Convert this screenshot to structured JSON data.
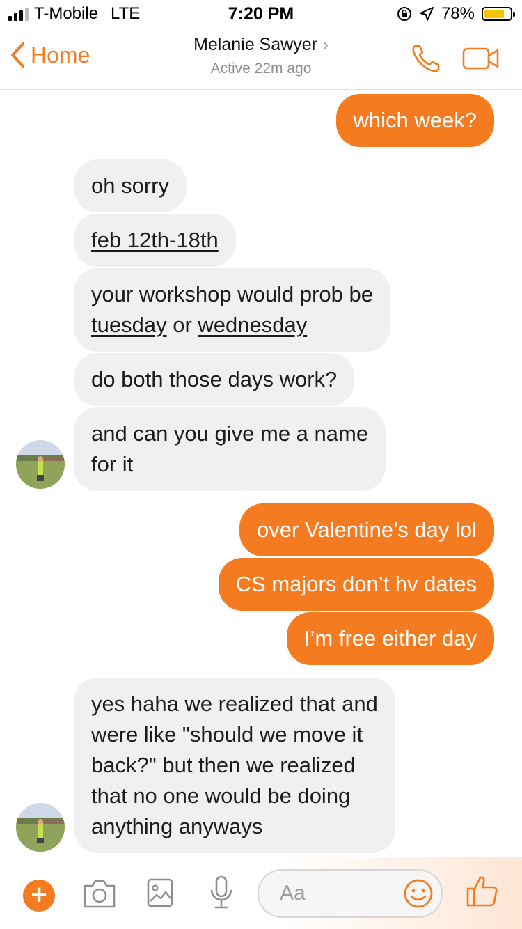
{
  "status_bar": {
    "carrier": "T-Mobile",
    "network": "LTE",
    "time": "7:20 PM",
    "battery_percent": "78%",
    "battery_level": 0.78,
    "colors": {
      "battery_fill": "#f5c400"
    }
  },
  "header": {
    "back_label": "Home",
    "contact_name": "Melanie Sawyer",
    "contact_status": "Active 22m ago",
    "accent": "#f47b20"
  },
  "messages": [
    {
      "from": "me",
      "text": "which week?"
    },
    {
      "from": "them",
      "text": "oh sorry"
    },
    {
      "from": "them",
      "text": "feb 12th-18th"
    },
    {
      "from": "them",
      "parts": [
        "your workshop would prob be",
        "tuesday",
        "or",
        "wednesday"
      ]
    },
    {
      "from": "them",
      "text": "do both those days work?"
    },
    {
      "from": "them",
      "lines": [
        "and can you give me a name",
        "for it"
      ]
    },
    {
      "from": "me",
      "text": "over Valentine’s day lol"
    },
    {
      "from": "me",
      "text": "CS majors don’t hv dates"
    },
    {
      "from": "me",
      "text": "I’m free either day"
    },
    {
      "from": "them",
      "lines": [
        "yes haha we realized that and",
        "were like \"should we move it",
        "back?\" but then we realized",
        "that no one would be doing",
        "anything anyways"
      ]
    }
  ],
  "composer": {
    "placeholder": "Aa"
  },
  "icons": {
    "header": [
      "chevron-left-icon",
      "chevron-right-icon",
      "phone-icon",
      "video-camera-icon"
    ],
    "composer": [
      "plus-icon",
      "camera-icon",
      "image-icon",
      "microphone-icon",
      "smiley-icon",
      "thumbs-up-icon"
    ]
  }
}
